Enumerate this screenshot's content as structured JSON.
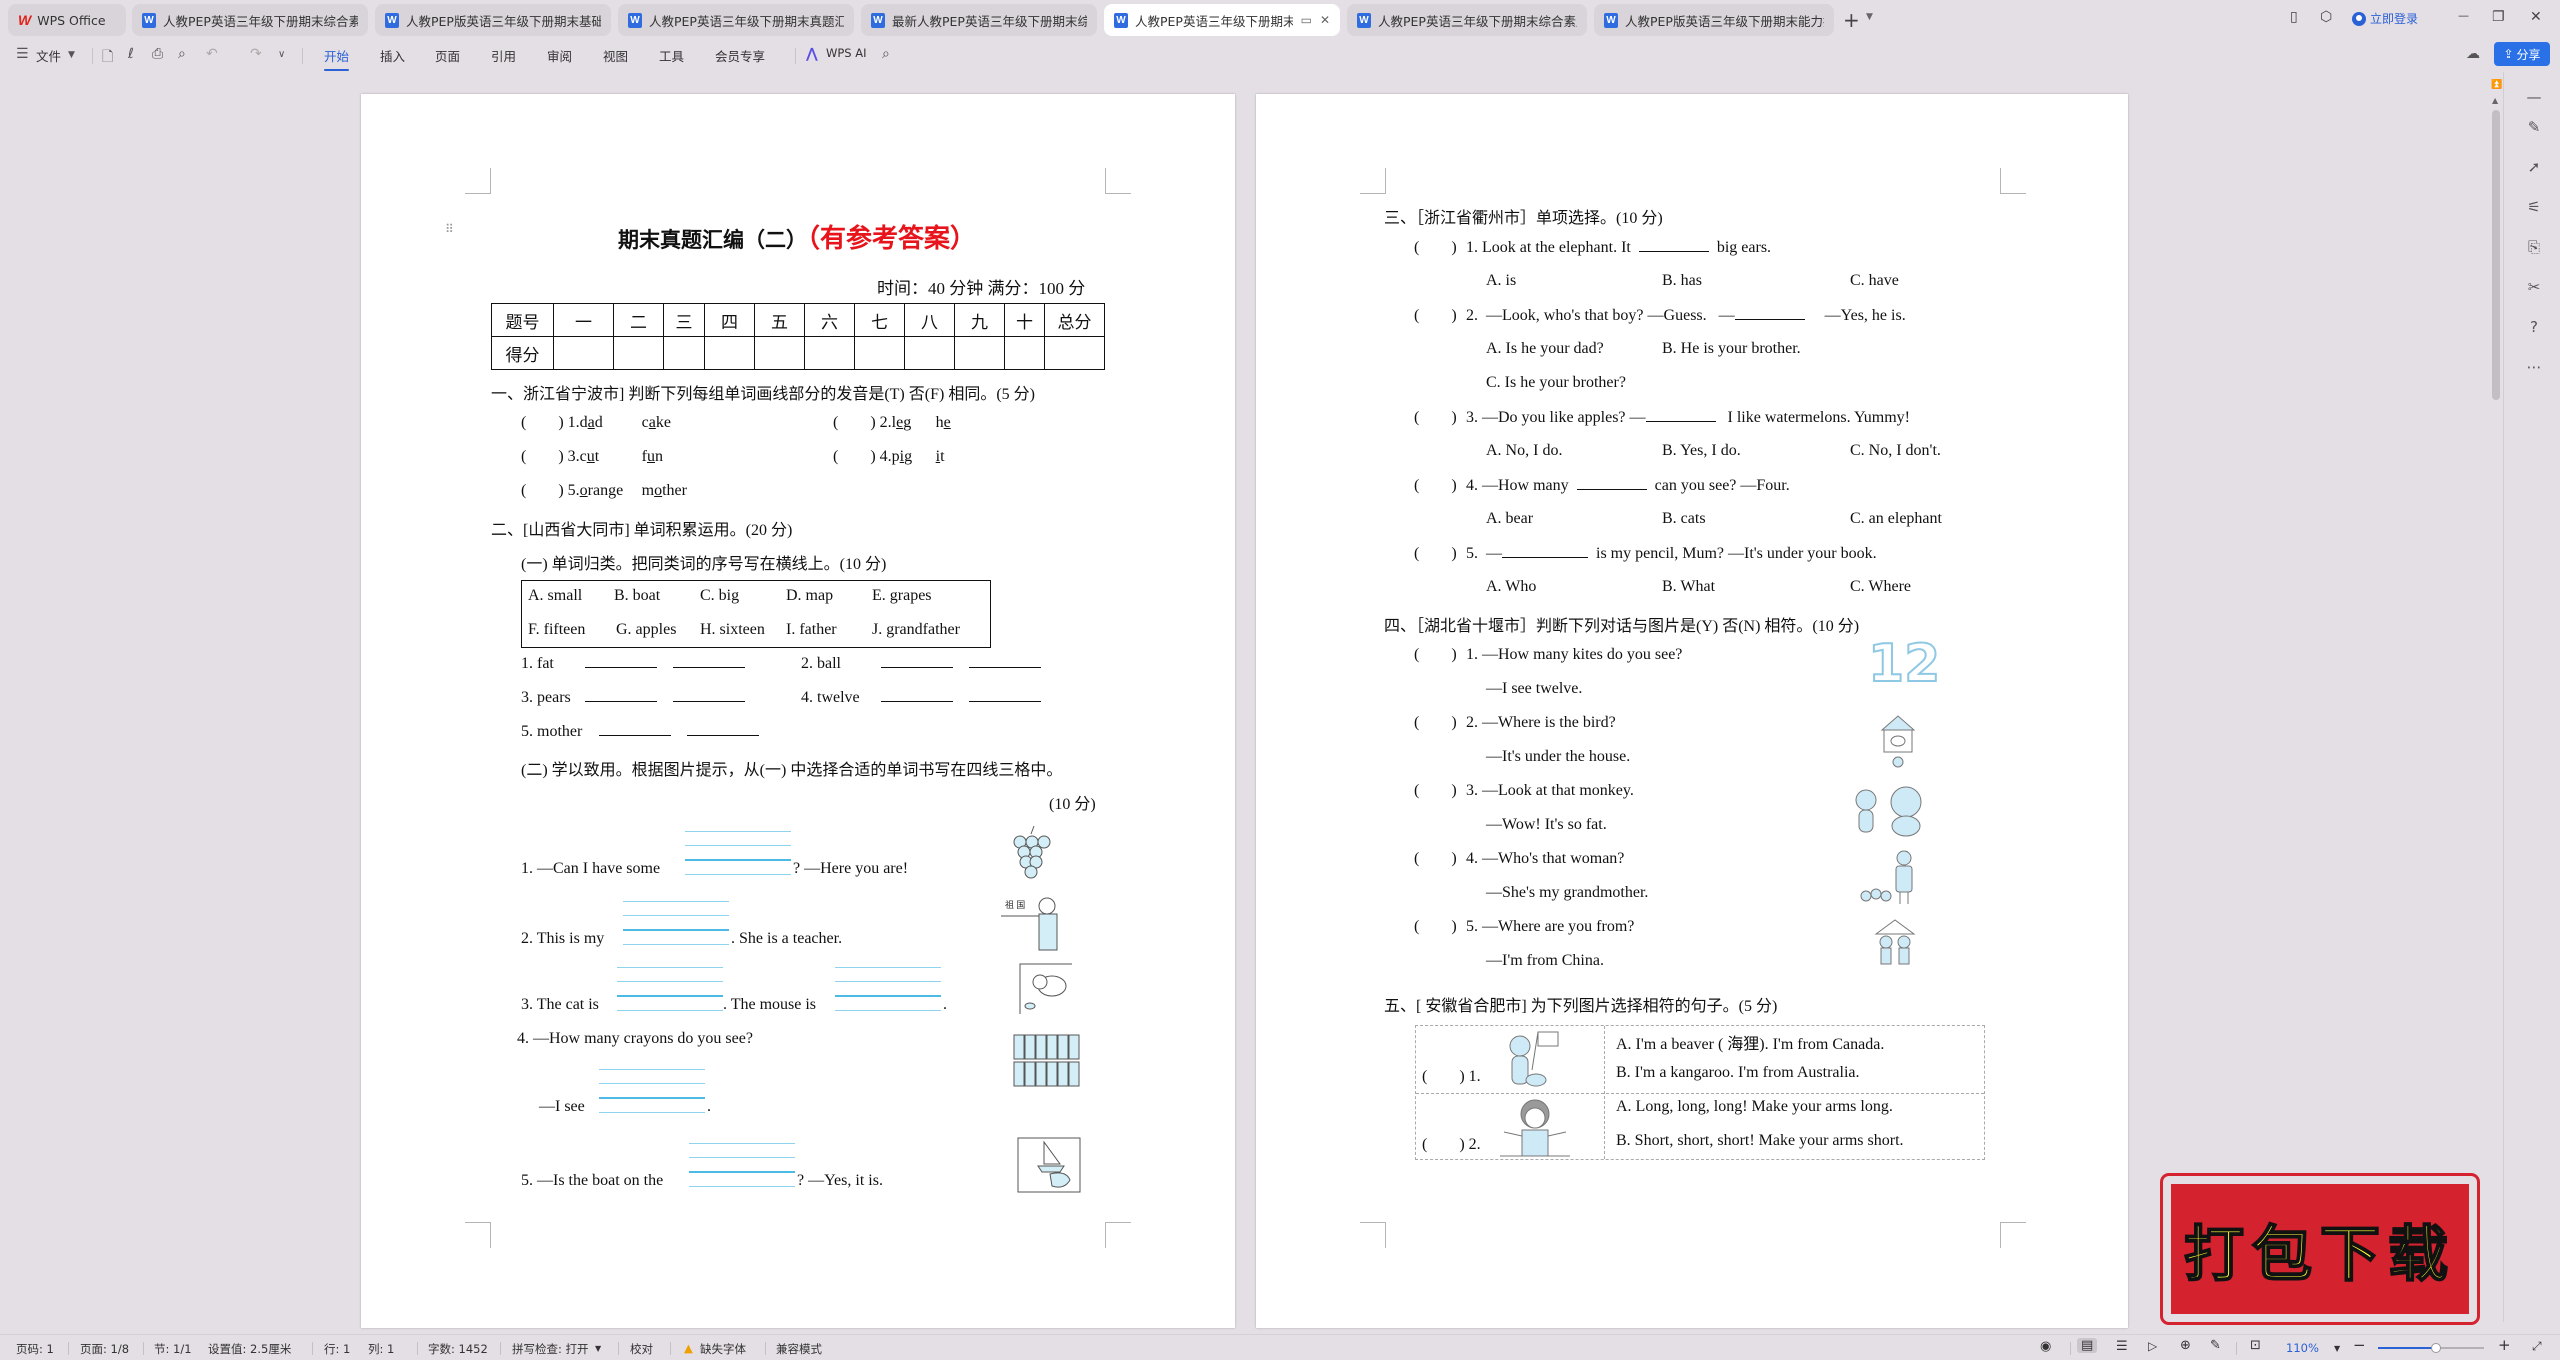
{
  "tabs": [
    {
      "label": "WPS Office",
      "type": "wps"
    },
    {
      "label": "人教PEP英语三年级下册期末综合素质",
      "type": "doc"
    },
    {
      "label": "人教PEP版英语三年级下册期末基础达",
      "type": "doc"
    },
    {
      "label": "人教PEP英语三年级下册期末真题汇编",
      "type": "doc"
    },
    {
      "label": "最新人教PEP英语三年级下册期末综合",
      "type": "doc"
    },
    {
      "label": "人教PEP英语三年级下册期末真",
      "type": "doc",
      "active": true
    },
    {
      "label": "人教PEP英语三年级下册期末综合素质",
      "type": "doc"
    },
    {
      "label": "人教PEP版英语三年级下册期末能力提",
      "type": "doc"
    }
  ],
  "titlebar": {
    "login_label": "立即登录",
    "new_tab": "+",
    "minimize": "—",
    "restore": "❐",
    "close": "✕"
  },
  "ribbon": {
    "file_menu": "文件",
    "tabs": [
      "开始",
      "插入",
      "页面",
      "引用",
      "审阅",
      "视图",
      "工具",
      "会员专享"
    ],
    "active_tab": "开始",
    "wps_ai": "WPS AI",
    "share": "分享"
  },
  "doc": {
    "title": "期末真题汇编（二）",
    "title_tag": "（有参考答案）",
    "meta": "时间：40 分钟   满分：100 分",
    "score_table": {
      "row1": [
        "题号",
        "一",
        "二",
        "三",
        "四",
        "五",
        "六",
        "七",
        "八",
        "九",
        "十",
        "总分"
      ],
      "row2": [
        "得分",
        "",
        "",
        "",
        "",
        "",
        "",
        "",
        "",
        "",
        "",
        ""
      ]
    },
    "s1": {
      "heading": "一、浙江省宁波市] 判断下列每组单词画线部分的发音是(T) 否(F) 相同。(5 分)",
      "items": [
        {
          "paren": "(        )",
          "num": "1.",
          "w1": "dad",
          "w2": "cake"
        },
        {
          "paren": "(        )",
          "num": "2.",
          "w1": "leg",
          "w2": "he"
        },
        {
          "paren": "(        )",
          "num": "3.",
          "w1": "cut",
          "w2": "fun"
        },
        {
          "paren": "(        )",
          "num": "4.",
          "w1": "pig",
          "w2": "it"
        },
        {
          "paren": "(        )",
          "num": "5.",
          "w1": "orange",
          "w2": "mother"
        }
      ]
    },
    "s2": {
      "heading": "二、[山西省大同市] 单词积累运用。(20 分)",
      "sub1": "(一) 单词归类。把同类词的序号写在横线上。(10 分)",
      "words": [
        "A. small",
        "B. boat",
        "C. big",
        "D. map",
        "E. grapes",
        "F. fifteen",
        "G. apples",
        "H. sixteen",
        "I. father",
        "J. grandfather"
      ],
      "classify": [
        "1. fat",
        "2. ball",
        "3. pears",
        "4. twelve",
        "5. mother"
      ],
      "sub2": "(二) 学以致用。根据图片提示，从(一) 中选择合适的单词书写在四线三格中。",
      "sub2_score": "(10 分)",
      "q1a": "1. —Can I have some",
      "q1b": "? —Here you are!",
      "q2a": "2. This is my",
      "q2b": ". She is a teacher.",
      "q3a": "3. The cat is",
      "q3b": ". The mouse is",
      "q3c": ".",
      "q4a": "4. —How many crayons do you see?",
      "q4b": "—I see",
      "q4c": ".",
      "q5a": "5. —Is the boat on the",
      "q5b": "? —Yes, it is.",
      "pic_teacher_text": "祖 国"
    },
    "s3": {
      "heading": "三、［浙江省衢州市］单项选择。(10 分)",
      "items": [
        {
          "paren": "(        )",
          "q": "1. Look at the elephant. It",
          "q2": "big ears.",
          "opts": [
            "A. is",
            "B. has",
            "C. have"
          ]
        },
        {
          "paren": "(        )",
          "q": "2.  —Look, who's that boy? —Guess.   —",
          "q2": "—Yes, he is.",
          "opts": [
            "A. Is he your dad?",
            "B. He is your brother.",
            "C. Is he your brother?"
          ]
        },
        {
          "paren": "(        )",
          "q": "3. —Do you like apples? —",
          "q2": "I like watermelons. Yummy!",
          "opts": [
            "A. No, I do.",
            "B. Yes, I do.",
            "C. No, I don't."
          ]
        },
        {
          "paren": "(        )",
          "q": "4.  —How many",
          "q2": "can you see?  —Four.",
          "opts": [
            "A. bear",
            "B. cats",
            "C. an elephant"
          ]
        },
        {
          "paren": "(        )",
          "q": "5.  —",
          "q2": "is my pencil, Mum?  —It's under your book.",
          "opts": [
            "A. Who",
            "B. What",
            "C. Where"
          ]
        }
      ]
    },
    "s4": {
      "heading": "四、［湖北省十堰市］判断下列对话与图片是(Y) 否(N) 相符。(10 分)",
      "items": [
        {
          "paren": "(        )",
          "q": "1. —How many kites do you see?",
          "a": "—I see twelve."
        },
        {
          "paren": "(        )",
          "q": "2. —Where is the bird?",
          "a": "—It's under the house."
        },
        {
          "paren": "(        )",
          "q": "3. —Look at that monkey.",
          "a": "—Wow! It's so fat."
        },
        {
          "paren": "(        )",
          "q": "4. —Who's that woman?",
          "a": "—She's my grandmother."
        },
        {
          "paren": "(        )",
          "q": "5. —Where are you from?",
          "a": "—I'm from China."
        }
      ],
      "pic1_number": "12"
    },
    "s5": {
      "heading": "五、[ 安徽省合肥市] 为下列图片选择相符的句子。(5 分)",
      "rows": [
        {
          "label": "(        ) 1.",
          "a": "A. I'm a beaver (  海狸). I'm from Canada.",
          "b": "B. I'm a kangaroo. I'm from Australia."
        },
        {
          "label": "(        ) 2.",
          "a": "A. Long, long, long! Make your arms long.",
          "b": "B. Short, short, short! Make your arms short."
        }
      ]
    }
  },
  "banner": {
    "text": "打包下载"
  },
  "statusbar": {
    "page_num": "页码: 1",
    "pages": "页面: 1/8",
    "section": "节: 1/1",
    "setting": "设置值: 2.5厘米",
    "row": "行: 1",
    "col": "列: 1",
    "words": "字数: 1452",
    "spell": "拼写检查: 打开",
    "proof": "校对",
    "missing_font": "缺失字体",
    "compat": "兼容模式",
    "zoom": "110%",
    "zoom_fraction": 0.55
  },
  "colors": {
    "accent": "#2a62d6",
    "title_red": "#e8141b",
    "banner_red": "#d4222f",
    "banner_text": "#ffff33"
  }
}
